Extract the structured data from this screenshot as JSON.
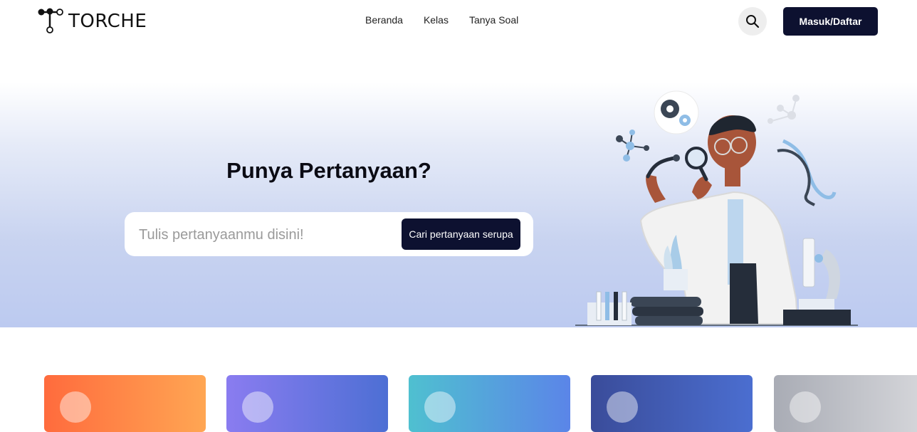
{
  "brand": {
    "name": "TORCHE"
  },
  "nav": {
    "links": [
      "Beranda",
      "Kelas",
      "Tanya Soal"
    ],
    "search_icon": "search-icon",
    "login_label": "Masuk/Daftar"
  },
  "hero": {
    "title": "Punya Pertanyaan?",
    "search_placeholder": "Tulis pertanyaanmu disini!",
    "search_button": "Cari pertanyaan serupa"
  },
  "colors": {
    "primary": "#0d1130",
    "hero_bg": "#c8d3f0",
    "card_colors": [
      "#ff7a45",
      "#7b7ae6",
      "#53aee0",
      "#3f58b0",
      "#bdbec4"
    ]
  }
}
